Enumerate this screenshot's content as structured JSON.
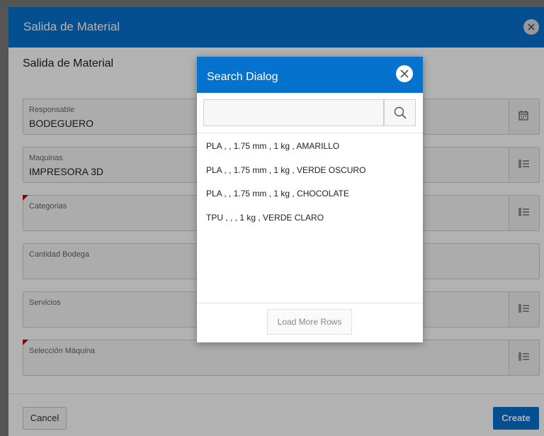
{
  "modal": {
    "title": "Salida de Material",
    "region_title": "Salida de Material"
  },
  "fields": [
    {
      "label": "Responsable",
      "value": "BODEGUERO",
      "button_icon": "calendar-icon"
    },
    {
      "label": "Maquinas",
      "value": "IMPRESORA 3D",
      "button_icon": "list-icon"
    },
    {
      "label": "Categorias",
      "value": "",
      "button_icon": "list-icon",
      "required": true
    },
    {
      "label": "Cantidad Bodega",
      "value": ""
    },
    {
      "label": "Servicios",
      "value": "",
      "button_icon": "list-icon"
    },
    {
      "label": "Selección Máquina",
      "value": "",
      "button_icon": "list-icon",
      "required": true
    }
  ],
  "footer": {
    "cancel_label": "Cancel",
    "create_label": "Create"
  },
  "dialog": {
    "title": "Search Dialog",
    "search_value": "",
    "results": [
      "PLA , , 1.75 mm , 1 kg , AMARILLO",
      "PLA , , 1.75 mm , 1 kg , VERDE OSCURO",
      "PLA , , 1.75 mm , 1 kg , CHOCOLATE",
      "TPU , , , 1 kg , VERDE CLARO"
    ],
    "load_more_label": "Load More Rows"
  },
  "colors": {
    "accent": "#0572ce",
    "required_marker": "#cc0000"
  }
}
